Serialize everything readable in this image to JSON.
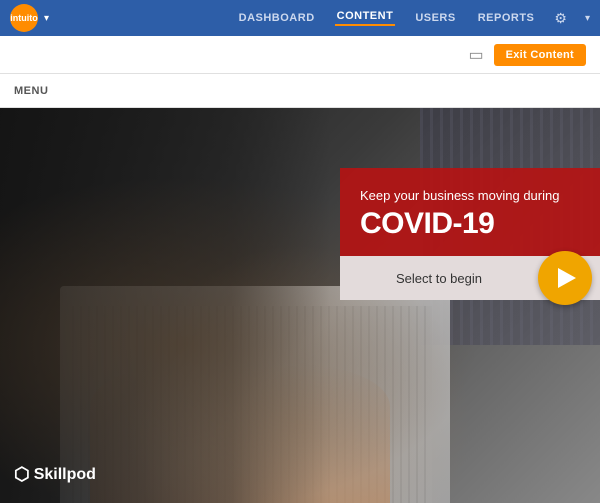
{
  "navbar": {
    "logo_text": "intuito",
    "nav_items": [
      {
        "label": "DASHBOARD",
        "active": false
      },
      {
        "label": "CONTENT",
        "active": true
      },
      {
        "label": "USERS",
        "active": false
      },
      {
        "label": "REPORTS",
        "active": false
      }
    ],
    "gear_label": "⚙"
  },
  "toolbar": {
    "monitor_icon": "⬜",
    "exit_button_label": "Exit Content"
  },
  "menu": {
    "label": "MENU"
  },
  "hero": {
    "subtitle": "Keep your business moving during",
    "title": "COVID-19",
    "select_label": "Select to begin",
    "brand_name": "Skillpod"
  }
}
